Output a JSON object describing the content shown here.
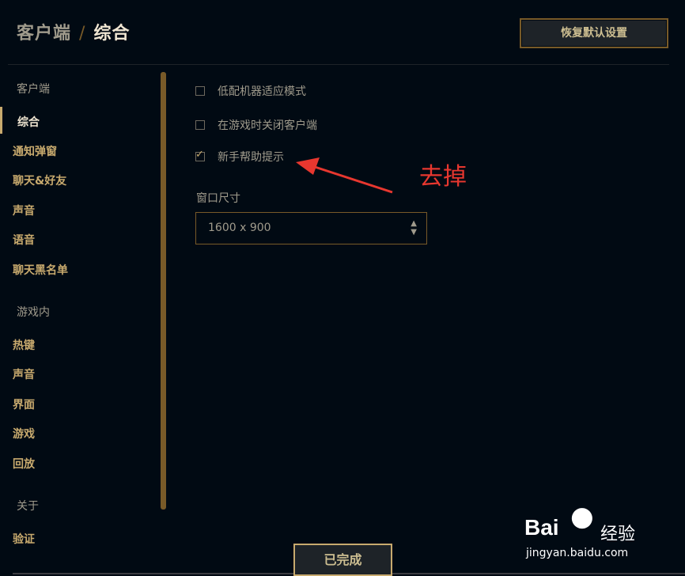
{
  "header": {
    "breadcrumb_parent": "客户端",
    "separator": "/",
    "current": "综合",
    "reset_button": "恢复默认设置"
  },
  "sidebar": {
    "section_client": "客户端",
    "client_items": [
      "综合",
      "通知弹窗",
      "聊天&好友",
      "声音",
      "语音",
      "聊天黑名单"
    ],
    "section_ingame": "游戏内",
    "ingame_items": [
      "热键",
      "声音",
      "界面",
      "游戏",
      "回放"
    ],
    "section_about": "关于",
    "about_items": [
      "验证"
    ]
  },
  "options": [
    {
      "label": "低配机器适应模式",
      "checked": false
    },
    {
      "label": "在游戏时关闭客户端",
      "checked": false
    },
    {
      "label": "新手帮助提示",
      "checked": true
    }
  ],
  "window_size": {
    "label": "窗口尺寸",
    "value": "1600 x 900"
  },
  "annotation": "去掉",
  "footer": {
    "done_button": "已完成"
  },
  "watermark": {
    "brand": "Bai",
    "suffix": "经验",
    "url": "jingyan.baidu.com"
  },
  "colors": {
    "background": "#010a13",
    "gold": "#c8aa6e",
    "gold_dark": "#785a28",
    "text_light": "#f0e6d2",
    "annotation": "#e8372f"
  }
}
